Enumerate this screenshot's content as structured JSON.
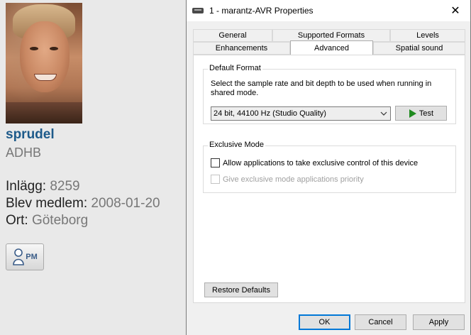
{
  "profile": {
    "username": "sprudel",
    "user_title": "ADHB",
    "posts_label": "Inlägg:",
    "posts_value": "8259",
    "joined_label": "Blev medlem:",
    "joined_value": "2008-01-20",
    "location_label": "Ort:",
    "location_value": "Göteborg",
    "pm_label": "PM"
  },
  "dialog": {
    "title": "1 - marantz-AVR Properties",
    "tabs_row1": [
      "General",
      "Supported Formats",
      "Levels"
    ],
    "tabs_row2": [
      "Enhancements",
      "Advanced",
      "Spatial sound"
    ],
    "active_tab": "Advanced",
    "default_format": {
      "label": "Default Format",
      "description": "Select the sample rate and bit depth to be used when running in shared mode.",
      "selected": "24 bit, 44100 Hz (Studio Quality)",
      "test_label": "Test"
    },
    "exclusive_mode": {
      "label": "Exclusive Mode",
      "allow_label": "Allow applications to take exclusive control of this device",
      "allow_checked": false,
      "priority_label": "Give exclusive mode applications priority",
      "priority_checked": false,
      "priority_enabled": false
    },
    "restore_label": "Restore Defaults",
    "ok_label": "OK",
    "cancel_label": "Cancel",
    "apply_label": "Apply"
  },
  "colors": {
    "username": "#1d5a8a",
    "muted_text": "#777777",
    "default_button_border": "#0078d7",
    "play_icon": "#1f8a1f"
  }
}
